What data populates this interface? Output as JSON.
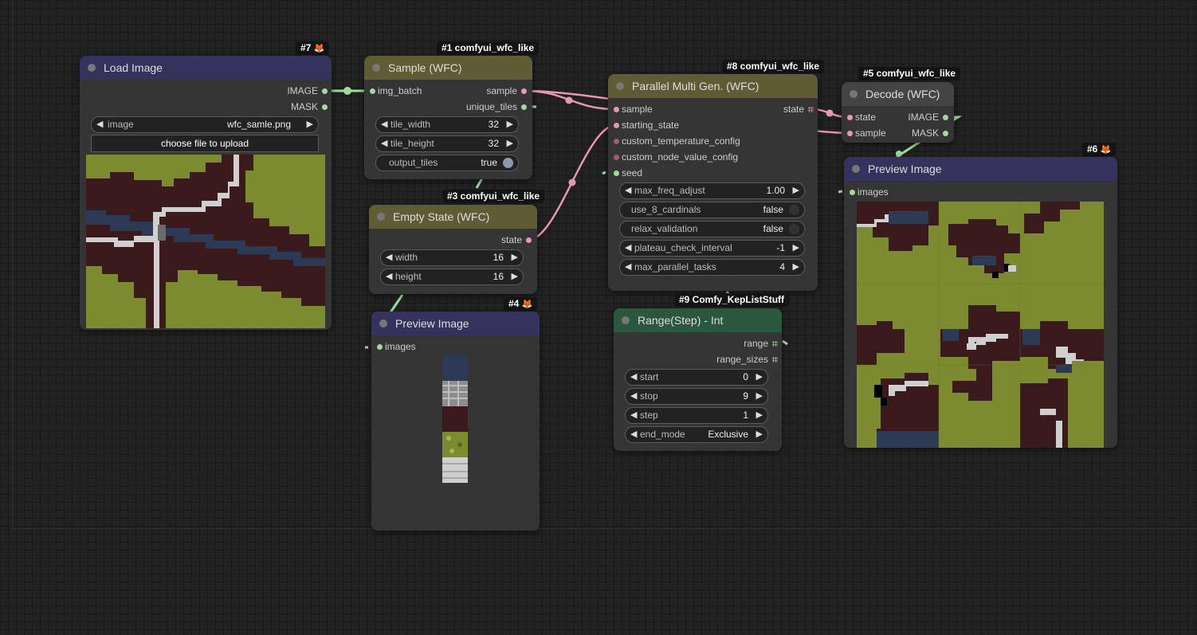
{
  "colors": {
    "canvas_bg": "#222222",
    "node_body": "#353535",
    "title_purple": "#35335e",
    "title_olive": "#5f5b34",
    "title_green": "#2c573f",
    "link_green": "#9fdb9c",
    "link_pink": "#e796b6",
    "grass": "#7c8a30",
    "dirt": "#3a1a1c",
    "water": "#2c3a55",
    "stone": "#cfcfcf"
  },
  "nodes": {
    "load_image": {
      "badge": "#7",
      "badge_icon": "fox-icon",
      "title": "Load Image",
      "outputs": [
        "IMAGE",
        "MASK"
      ],
      "image_widget_label": "image",
      "image_widget_value": "wfc_samle.png",
      "upload_label": "choose file to upload"
    },
    "sample": {
      "badge": "#1 comfyui_wfc_like",
      "title": "Sample (WFC)",
      "input": "img_batch",
      "outputs": [
        "sample",
        "unique_tiles"
      ],
      "tile_width_label": "tile_width",
      "tile_width_value": "32",
      "tile_height_label": "tile_height",
      "tile_height_value": "32",
      "output_tiles_label": "output_tiles",
      "output_tiles_value": "true"
    },
    "empty_state": {
      "badge": "#3 comfyui_wfc_like",
      "title": "Empty State (WFC)",
      "output": "state",
      "width_label": "width",
      "width_value": "16",
      "height_label": "height",
      "height_value": "16"
    },
    "parallel": {
      "badge": "#8 comfyui_wfc_like",
      "title": "Parallel Multi Gen. (WFC)",
      "inputs": [
        "sample",
        "starting_state",
        "custom_temperature_config",
        "custom_node_value_config",
        "seed"
      ],
      "output": "state",
      "widgets": [
        {
          "label": "max_freq_adjust",
          "value": "1.00"
        },
        {
          "label": "use_8_cardinals",
          "value": "false"
        },
        {
          "label": "relax_validation",
          "value": "false"
        },
        {
          "label": "plateau_check_interval",
          "value": "-1"
        },
        {
          "label": "max_parallel_tasks",
          "value": "4"
        }
      ]
    },
    "decode": {
      "badge": "#5 comfyui_wfc_like",
      "title": "Decode (WFC)",
      "inputs": [
        "state",
        "sample"
      ],
      "outputs": [
        "IMAGE",
        "MASK"
      ]
    },
    "preview_small": {
      "badge": "#4",
      "badge_icon": "fox-icon",
      "title": "Preview Image",
      "input": "images"
    },
    "preview_big": {
      "badge": "#6",
      "badge_icon": "fox-icon",
      "title": "Preview Image",
      "input": "images"
    },
    "range": {
      "badge": "#9 Comfy_KepListStuff",
      "title": "Range(Step) - Int",
      "outputs": [
        "range",
        "range_sizes"
      ],
      "widgets": [
        {
          "label": "start",
          "value": "0"
        },
        {
          "label": "stop",
          "value": "9"
        },
        {
          "label": "step",
          "value": "1"
        },
        {
          "label": "end_mode",
          "value": "Exclusive"
        }
      ]
    }
  }
}
